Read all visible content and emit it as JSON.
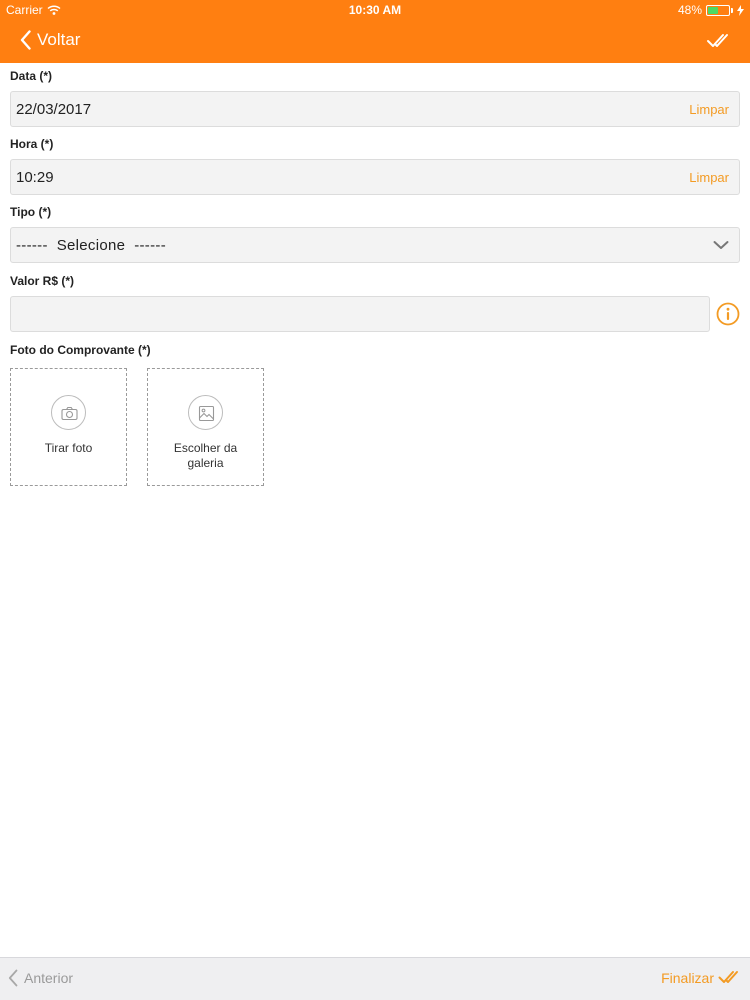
{
  "status_bar": {
    "carrier": "Carrier",
    "time": "10:30 AM",
    "battery_percent": "48%",
    "battery_level": 0.48
  },
  "nav": {
    "back_label": "Voltar"
  },
  "form": {
    "date": {
      "label": "Data (*)",
      "value": "22/03/2017",
      "clear_label": "Limpar"
    },
    "time": {
      "label": "Hora (*)",
      "value": "10:29",
      "clear_label": "Limpar"
    },
    "type": {
      "label": "Tipo (*)",
      "selected": "------  Selecione  ------"
    },
    "amount": {
      "label": "Valor R$ (*)",
      "value": "",
      "placeholder": ""
    },
    "receipt": {
      "label": "Foto do Comprovante (*)",
      "take_photo_label": "Tirar foto",
      "gallery_label_line1": "Escolher da",
      "gallery_label_line2": "galeria"
    }
  },
  "footer": {
    "previous_label": "Anterior",
    "finish_label": "Finalizar"
  },
  "colors": {
    "accent": "#ff7f11",
    "link": "#f39b24",
    "battery": "#4cd964"
  }
}
